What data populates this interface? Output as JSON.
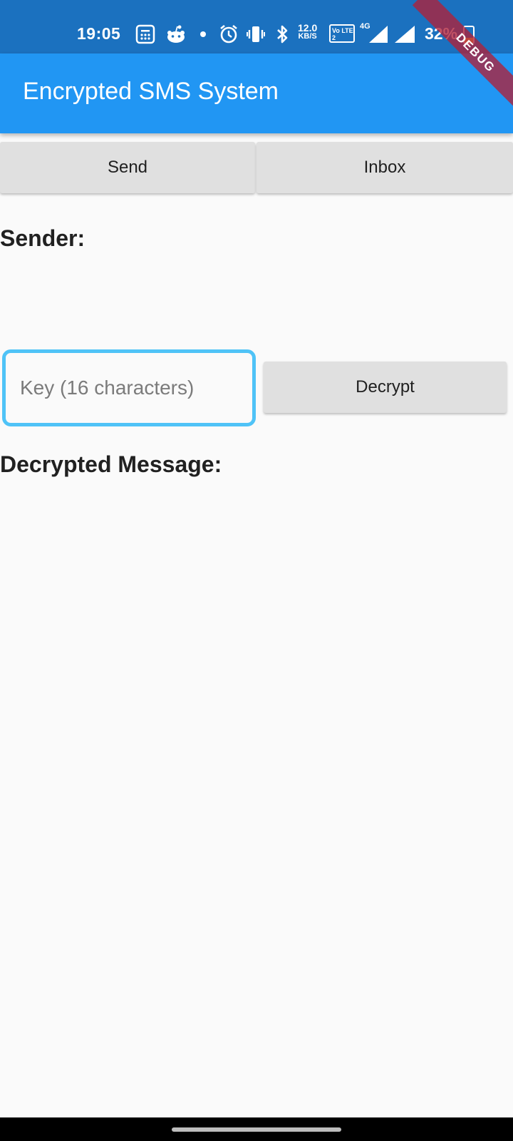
{
  "status_bar": {
    "time": "19:05",
    "net_speed_value": "12.0",
    "net_speed_unit": "KB/S",
    "volte_label": "Vo LTE 2",
    "network_type": "4G",
    "battery_percent": "32%",
    "battery_level": 0.32,
    "icons": [
      "calculator-icon",
      "reddit-icon",
      "dot-icon",
      "alarm-icon",
      "vibrate-icon",
      "bluetooth-icon",
      "signal-icon",
      "signal-icon-2",
      "battery-icon"
    ]
  },
  "debug_banner": "DEBUG",
  "app_bar": {
    "title": "Encrypted SMS System",
    "color": "#2196f3"
  },
  "tabs": {
    "send_label": "Send",
    "inbox_label": "Inbox"
  },
  "main": {
    "sender_label": "Sender:",
    "key_input": {
      "placeholder": "Key (16 characters)",
      "value": ""
    },
    "decrypt_label": "Decrypt",
    "decrypted_label": "Decrypted Message:"
  },
  "colors": {
    "status_bar": "#1b71bf",
    "focus_border": "#4fc3f7",
    "button_bg": "#e0e0e0"
  }
}
